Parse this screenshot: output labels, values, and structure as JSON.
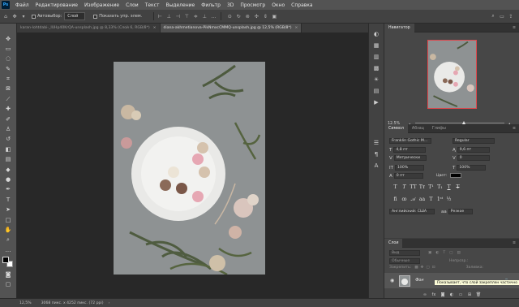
{
  "app": {
    "logo": "Ps"
  },
  "menu": [
    "Файл",
    "Редактирование",
    "Изображение",
    "Слои",
    "Текст",
    "Выделение",
    "Фильтр",
    "3D",
    "Просмотр",
    "Окно",
    "Справка"
  ],
  "options": {
    "autoselect_label": "Автовыбор:",
    "layer_dropdown": "Слой",
    "show_controls_label": "Показать упр. элем."
  },
  "tabs": [
    {
      "label": "karan-lohtdabi-_IUHp40KrQA-unsplash.jpg @ 8,33% (Слой 6, RGB/8*)",
      "active": false
    },
    {
      "label": "diana-akhmetianova-PikNmxcCMMQ-unsplash.jpg @ 12,5% (RGB/8*)",
      "active": true
    }
  ],
  "status": {
    "zoom": "12,5%",
    "info": "3068 пикс. x 4252 пикс. (72 ppi)"
  },
  "navigator": {
    "title": "Навигатор",
    "zoom": "12,5%",
    "zoom_fraction": 0.55
  },
  "character": {
    "tabs": [
      "Символ",
      "Абзац",
      "Глифы"
    ],
    "font_family": "Franklin Gothic M...",
    "font_style": "Regular",
    "font_size": "4,8 пт",
    "leading": "9,6 пт",
    "kerning": "Метрически",
    "tracking": "0",
    "vscale": "100%",
    "hscale": "100%",
    "baseline": "0 пт",
    "color_label": "Цвет:",
    "language": "Английский: США",
    "aa_icon": "аа",
    "antialias": "Резкое"
  },
  "layers": {
    "title": "Слои",
    "search_placeholder": "Вид",
    "blend": "Обычные",
    "opacity_label": "Непрозр.:",
    "lock_label": "Закрепить:",
    "fill_label": "Заливка:",
    "layer_name": "Фон",
    "tooltip": "Показывает, что слой закреплен частично"
  },
  "colors": {
    "accent_frame": "#e0474c",
    "foreground": "#000000",
    "background": "#ffffff"
  }
}
